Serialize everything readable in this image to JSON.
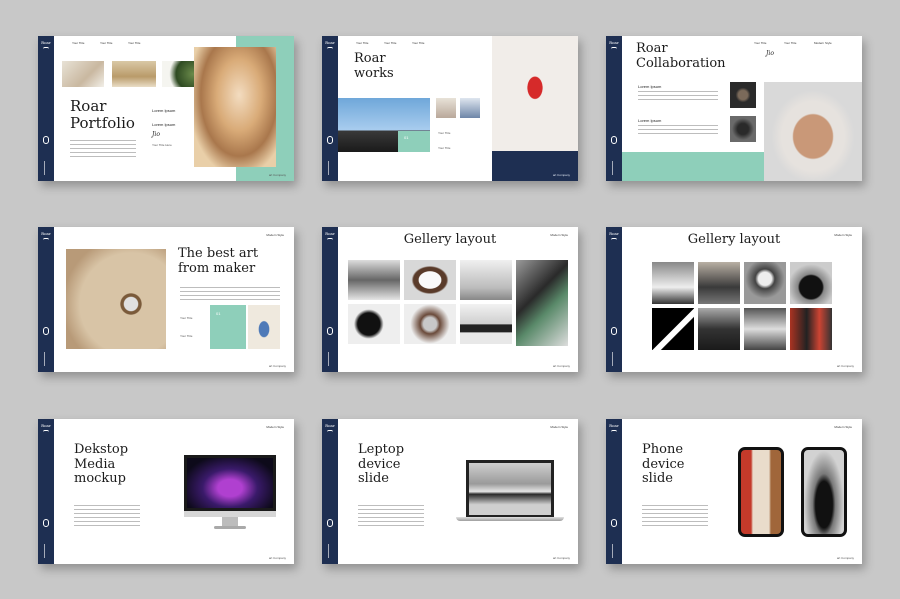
{
  "brand": "Roar",
  "slides": {
    "portfolio": {
      "title_line1": "Roar",
      "title_line2": "Portfolio",
      "nav": [
        "Your Title",
        "Your Title",
        "Your Title"
      ],
      "list": [
        "Lorem Ipsum",
        "Lorem Ipsum"
      ],
      "sig": "Jio",
      "sig_name": "Your Title Here",
      "footer": "art Company"
    },
    "works": {
      "title_line1": "Roar",
      "title_line2": "works",
      "nav": [
        "Your Title",
        "Your Title",
        "Your Title"
      ],
      "badge": "01",
      "labels": [
        "Your Title",
        "Your Title"
      ],
      "footer": "art Company"
    },
    "collab": {
      "title_line1": "Roar",
      "title_line2": "Collaboration",
      "nav": [
        "Your Title",
        "Your Title",
        "Modern Style"
      ],
      "sig": "Jio",
      "items": [
        "Lorem Ipsum",
        "Lorem Ipsum"
      ],
      "footer": "art Company"
    },
    "bestart": {
      "title_line1": "The best art",
      "title_line2": "from maker",
      "hdr": "Modern Style",
      "badge": "01",
      "labels": [
        "Your Title",
        "Your Title"
      ],
      "footer": "art Company"
    },
    "gallery1": {
      "title": "Gellery layout",
      "hdr": "Modern Style",
      "footer": "art Company"
    },
    "gallery2": {
      "title": "Gellery layout",
      "hdr": "Modern Style",
      "footer": "art Company"
    },
    "desktop": {
      "title_line1": "Dekstop",
      "title_line2": "Media",
      "title_line3": "mockup",
      "hdr": "Modern Style",
      "footer": "art Company"
    },
    "laptop": {
      "title_line1": "Leptop",
      "title_line2": "device",
      "title_line3": "slide",
      "hdr": "Modern Style",
      "footer": "art Company"
    },
    "phone": {
      "title_line1": "Phone",
      "title_line2": "device",
      "title_line3": "slide",
      "hdr": "Modern Style",
      "footer": "art Company"
    }
  },
  "colors": {
    "navy": "#1e2f52",
    "teal": "#8ecfba",
    "background": "#c8c8c8"
  }
}
